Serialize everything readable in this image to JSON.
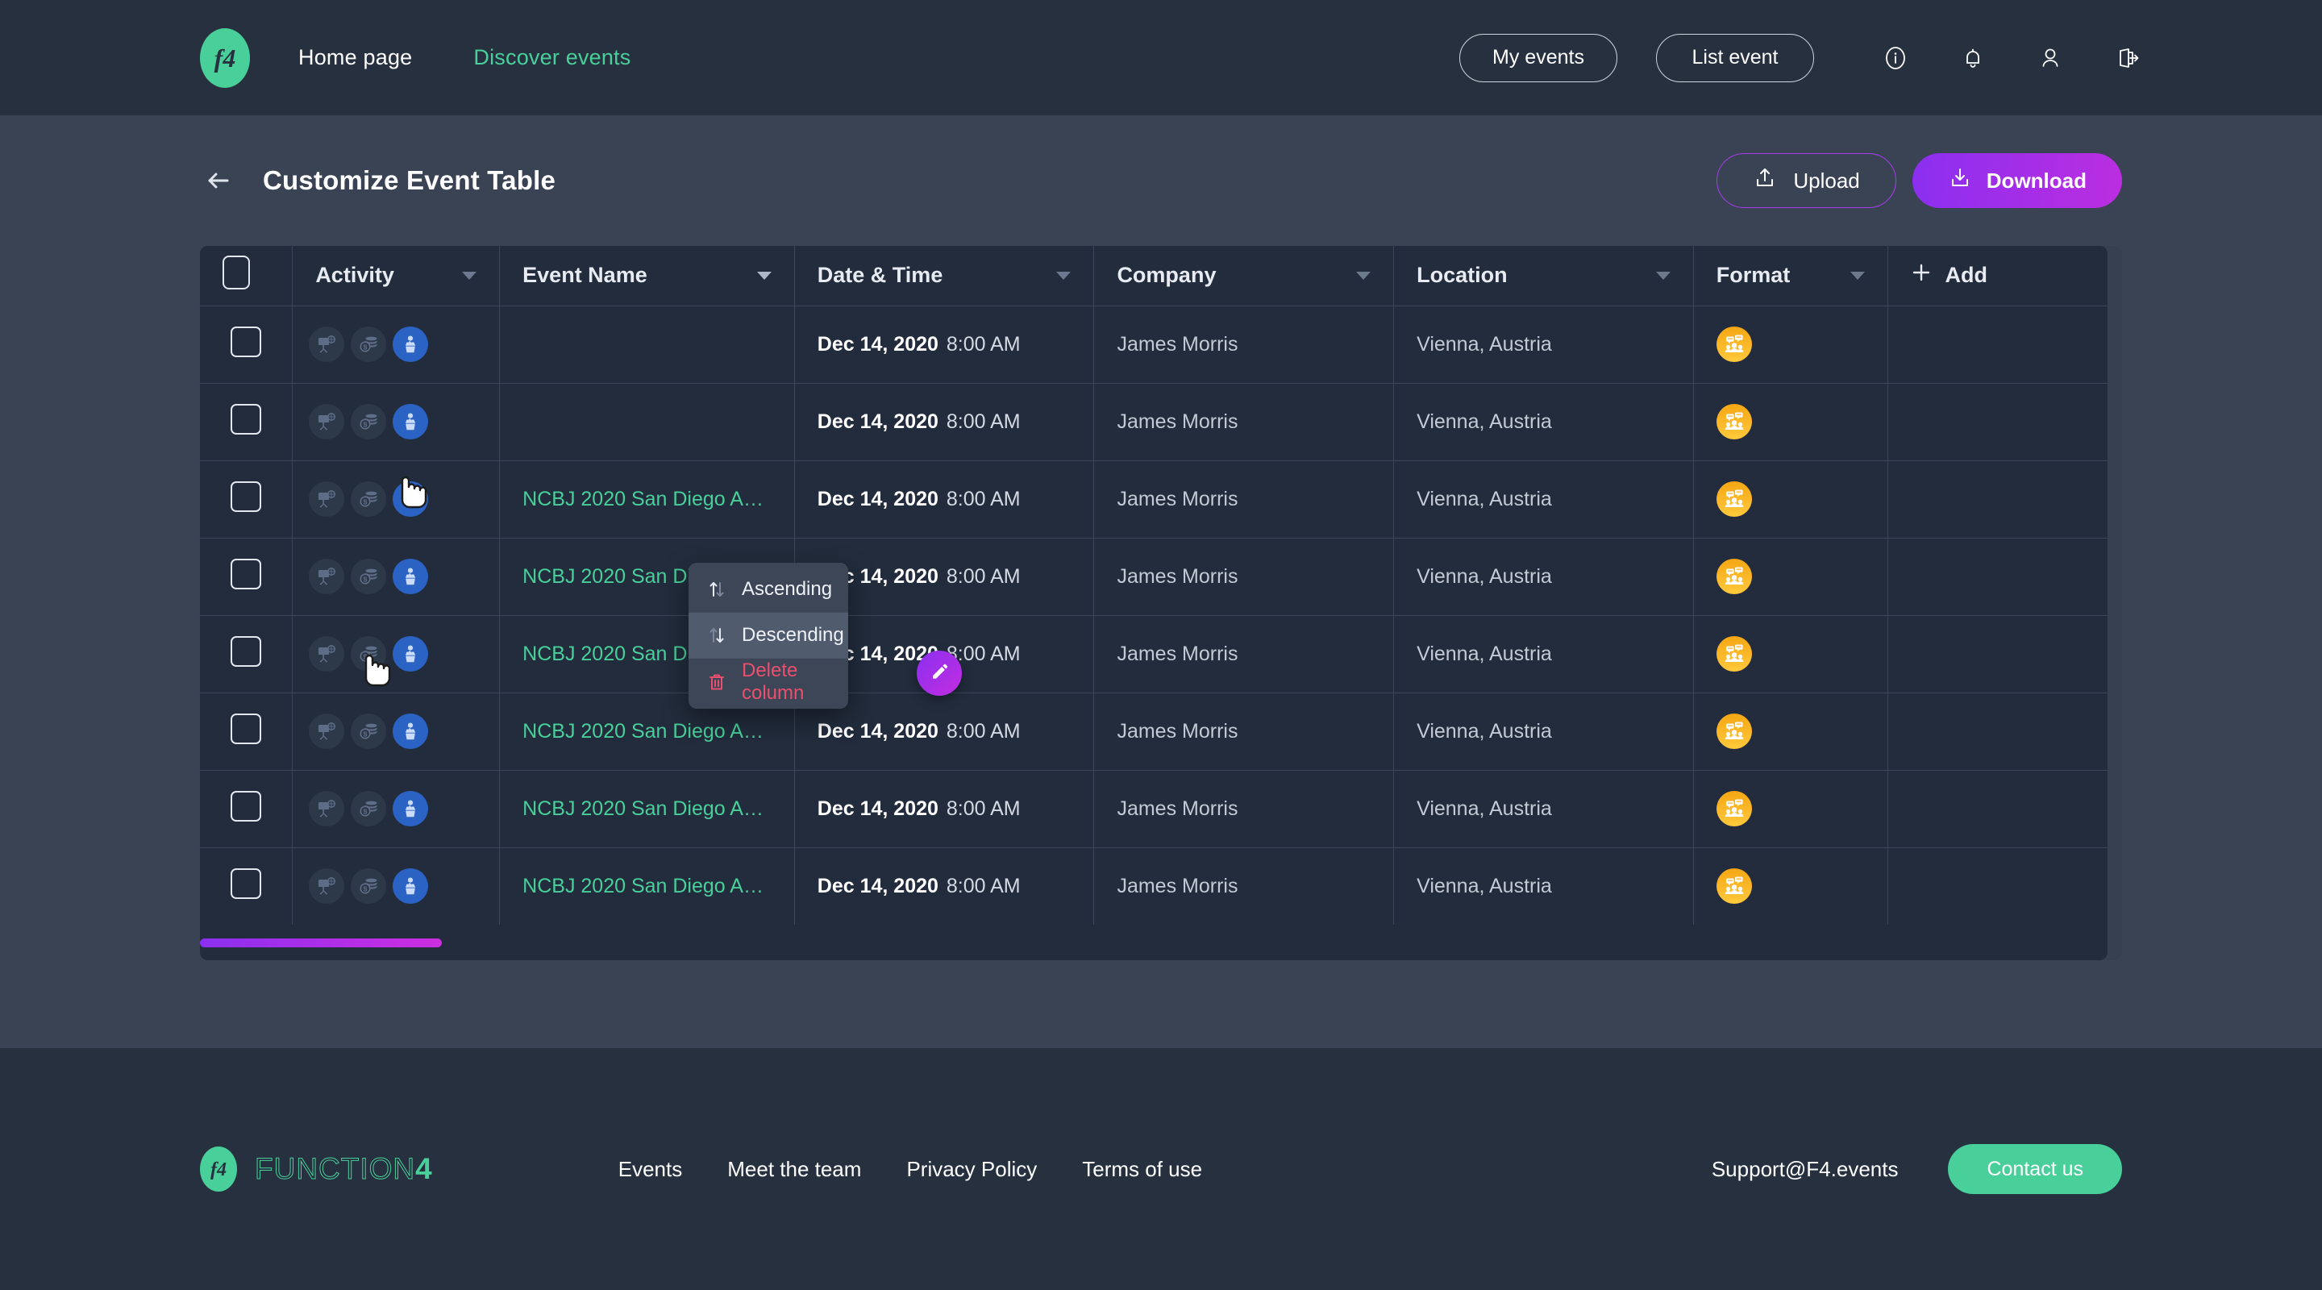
{
  "header": {
    "logo_alt": "f4",
    "nav": [
      {
        "label": "Home page",
        "accent": false
      },
      {
        "label": "Discover events",
        "accent": true
      }
    ],
    "my_events_label": "My events",
    "list_event_label": "List event",
    "icons": [
      "info-icon",
      "bell-icon",
      "user-icon",
      "logout-icon"
    ]
  },
  "page": {
    "title": "Customize Event Table",
    "back_label": "Back",
    "upload_label": "Upload",
    "download_label": "Download"
  },
  "table": {
    "columns": [
      {
        "key": "check",
        "label": "",
        "caret": false
      },
      {
        "key": "activity",
        "label": "Activity",
        "caret": true
      },
      {
        "key": "name",
        "label": "Event Name",
        "caret": true
      },
      {
        "key": "date",
        "label": "Date & Time",
        "caret": true
      },
      {
        "key": "company",
        "label": "Company",
        "caret": true
      },
      {
        "key": "location",
        "label": "Location",
        "caret": true
      },
      {
        "key": "format",
        "label": "Format",
        "caret": true
      },
      {
        "key": "add",
        "label": "Add",
        "caret": false
      }
    ],
    "activity_icons": [
      "presentation-globe-icon",
      "money-coins-icon",
      "speaker-podium-icon"
    ],
    "format_icon": "discussion-group-icon",
    "rows": [
      {
        "name": "",
        "date": "Dec 14, 2020",
        "time": "8:00 AM",
        "company": "James Morris",
        "location": "Vienna, Austria"
      },
      {
        "name": "",
        "date": "Dec 14, 2020",
        "time": "8:00 AM",
        "company": "James Morris",
        "location": "Vienna, Austria"
      },
      {
        "name": "NCBJ 2020 San Diego Annu...",
        "date": "Dec 14, 2020",
        "time": "8:00 AM",
        "company": "James Morris",
        "location": "Vienna, Austria"
      },
      {
        "name": "NCBJ 2020 San Diego Annu...",
        "date": "Dec 14, 2020",
        "time": "8:00 AM",
        "company": "James Morris",
        "location": "Vienna, Austria"
      },
      {
        "name": "NCBJ 2020 San Diego An",
        "date": "Dec 14, 2020",
        "time": "8:00 AM",
        "company": "James Morris",
        "location": "Vienna, Austria"
      },
      {
        "name": "NCBJ 2020 San Diego Annu...",
        "date": "Dec 14, 2020",
        "time": "8:00 AM",
        "company": "James Morris",
        "location": "Vienna, Austria"
      },
      {
        "name": "NCBJ 2020 San Diego Annu...",
        "date": "Dec 14, 2020",
        "time": "8:00 AM",
        "company": "James Morris",
        "location": "Vienna, Austria"
      },
      {
        "name": "NCBJ 2020 San Diego Annu...",
        "date": "Dec 14, 2020",
        "time": "8:00 AM",
        "company": "James Morris",
        "location": "Vienna, Austria"
      }
    ]
  },
  "column_menu": {
    "items": [
      {
        "label": "Ascending",
        "icon": "sort-ascending-icon",
        "highlighted": false,
        "danger": false
      },
      {
        "label": "Descending",
        "icon": "sort-descending-icon",
        "highlighted": true,
        "danger": false
      },
      {
        "label": "Delete column",
        "icon": "trash-icon",
        "highlighted": false,
        "danger": true
      }
    ]
  },
  "footer": {
    "wordmark_main": "FUNCTION",
    "wordmark_accent": "4",
    "links": [
      "Events",
      "Meet the team",
      "Privacy Policy",
      "Terms of use"
    ],
    "support_email": "Support@F4.events",
    "contact_label": "Contact us"
  },
  "colors": {
    "accent_green": "#49cf9a",
    "accent_purple": "#b12ee0",
    "danger_red": "#ec4f6e",
    "header_bg": "#26303f",
    "page_bg": "#3a4353",
    "table_bg": "#222c3c",
    "format_orange": "#f5a614"
  }
}
